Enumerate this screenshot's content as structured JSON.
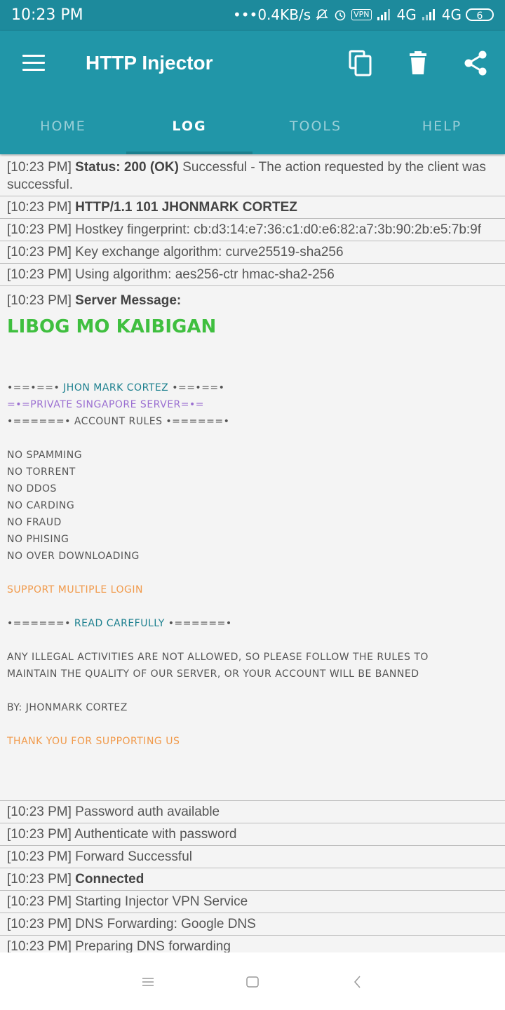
{
  "status_bar": {
    "time": "10:23 PM",
    "network_speed": "•••0.4KB/s",
    "vpn": "VPN",
    "net1": "4G",
    "net2": "4G",
    "battery": "6"
  },
  "app": {
    "title": "HTTP Injector",
    "accent": "#2196a8"
  },
  "tabs": [
    {
      "label": "HOME"
    },
    {
      "label": "LOG"
    },
    {
      "label": "TOOLS"
    },
    {
      "label": "HELP"
    }
  ],
  "log": {
    "entries_top": [
      {
        "ts": "[10:23 PM]",
        "bold": "Status: 200 (OK)",
        "rest": " Successful - The action requested by the client was successful."
      },
      {
        "ts": "[10:23 PM]",
        "bold": "HTTP/1.1 101 JHONMARK CORTEZ",
        "rest": ""
      },
      {
        "ts": "[10:23 PM]",
        "bold": "",
        "rest": " Hostkey fingerprint: cb:d3:14:e7:36:c1:d0:e6:82:a7:3b:90:2b:e5:7b:9f"
      },
      {
        "ts": "[10:23 PM]",
        "bold": "",
        "rest": " Key exchange algorithm: curve25519-sha256"
      },
      {
        "ts": "[10:23 PM]",
        "bold": "",
        "rest": " Using algorithm: aes256-ctr hmac-sha2-256"
      }
    ],
    "server_message": {
      "ts": "[10:23 PM]",
      "heading": "Server Message:",
      "banner": "LIBOG MO KAIBIGAN",
      "line_name_pre": "•==•==• ",
      "line_name": "JHON MARK CORTEZ",
      "line_name_post": " •==•==•",
      "line_server": "=•=PRIVATE SINGAPORE SERVER=•=",
      "line_rules": "•======• ACCOUNT RULES •======•",
      "rules": [
        "NO SPAMMING",
        "NO TORRENT",
        "NO DDOS",
        "NO CARDING",
        "NO FRAUD",
        "NO PHISING",
        "NO OVER DOWNLOADING"
      ],
      "support": "SUPPORT MULTIPLE LOGIN",
      "read_pre": "•======• ",
      "read": "READ CAREFULLY",
      "read_post": " •======•",
      "notice_1": "ANY ILLEGAL ACTIVITIES ARE NOT ALLOWED, SO PLEASE FOLLOW THE RULES TO",
      "notice_2": "MAINTAIN THE QUALITY OF OUR SERVER, OR YOUR ACCOUNT WILL BE BANNED",
      "by": "BY: JHONMARK CORTEZ",
      "thanks": "THANK YOU FOR SUPPORTING US"
    },
    "entries_bottom": [
      {
        "ts": "[10:23 PM]",
        "bold": "",
        "rest": " Password auth available"
      },
      {
        "ts": "[10:23 PM]",
        "bold": "",
        "rest": " Authenticate with password"
      },
      {
        "ts": "[10:23 PM]",
        "bold": "",
        "rest": " Forward Successful"
      },
      {
        "ts": "[10:23 PM]",
        "bold": "Connected",
        "rest": ""
      },
      {
        "ts": "[10:23 PM]",
        "bold": "",
        "rest": " Starting Injector VPN Service"
      },
      {
        "ts": "[10:23 PM]",
        "bold": "",
        "rest": " DNS Forwarding: Google DNS"
      },
      {
        "ts": "[10:23 PM]",
        "bold": "",
        "rest": " Preparing DNS forwarding"
      }
    ]
  }
}
